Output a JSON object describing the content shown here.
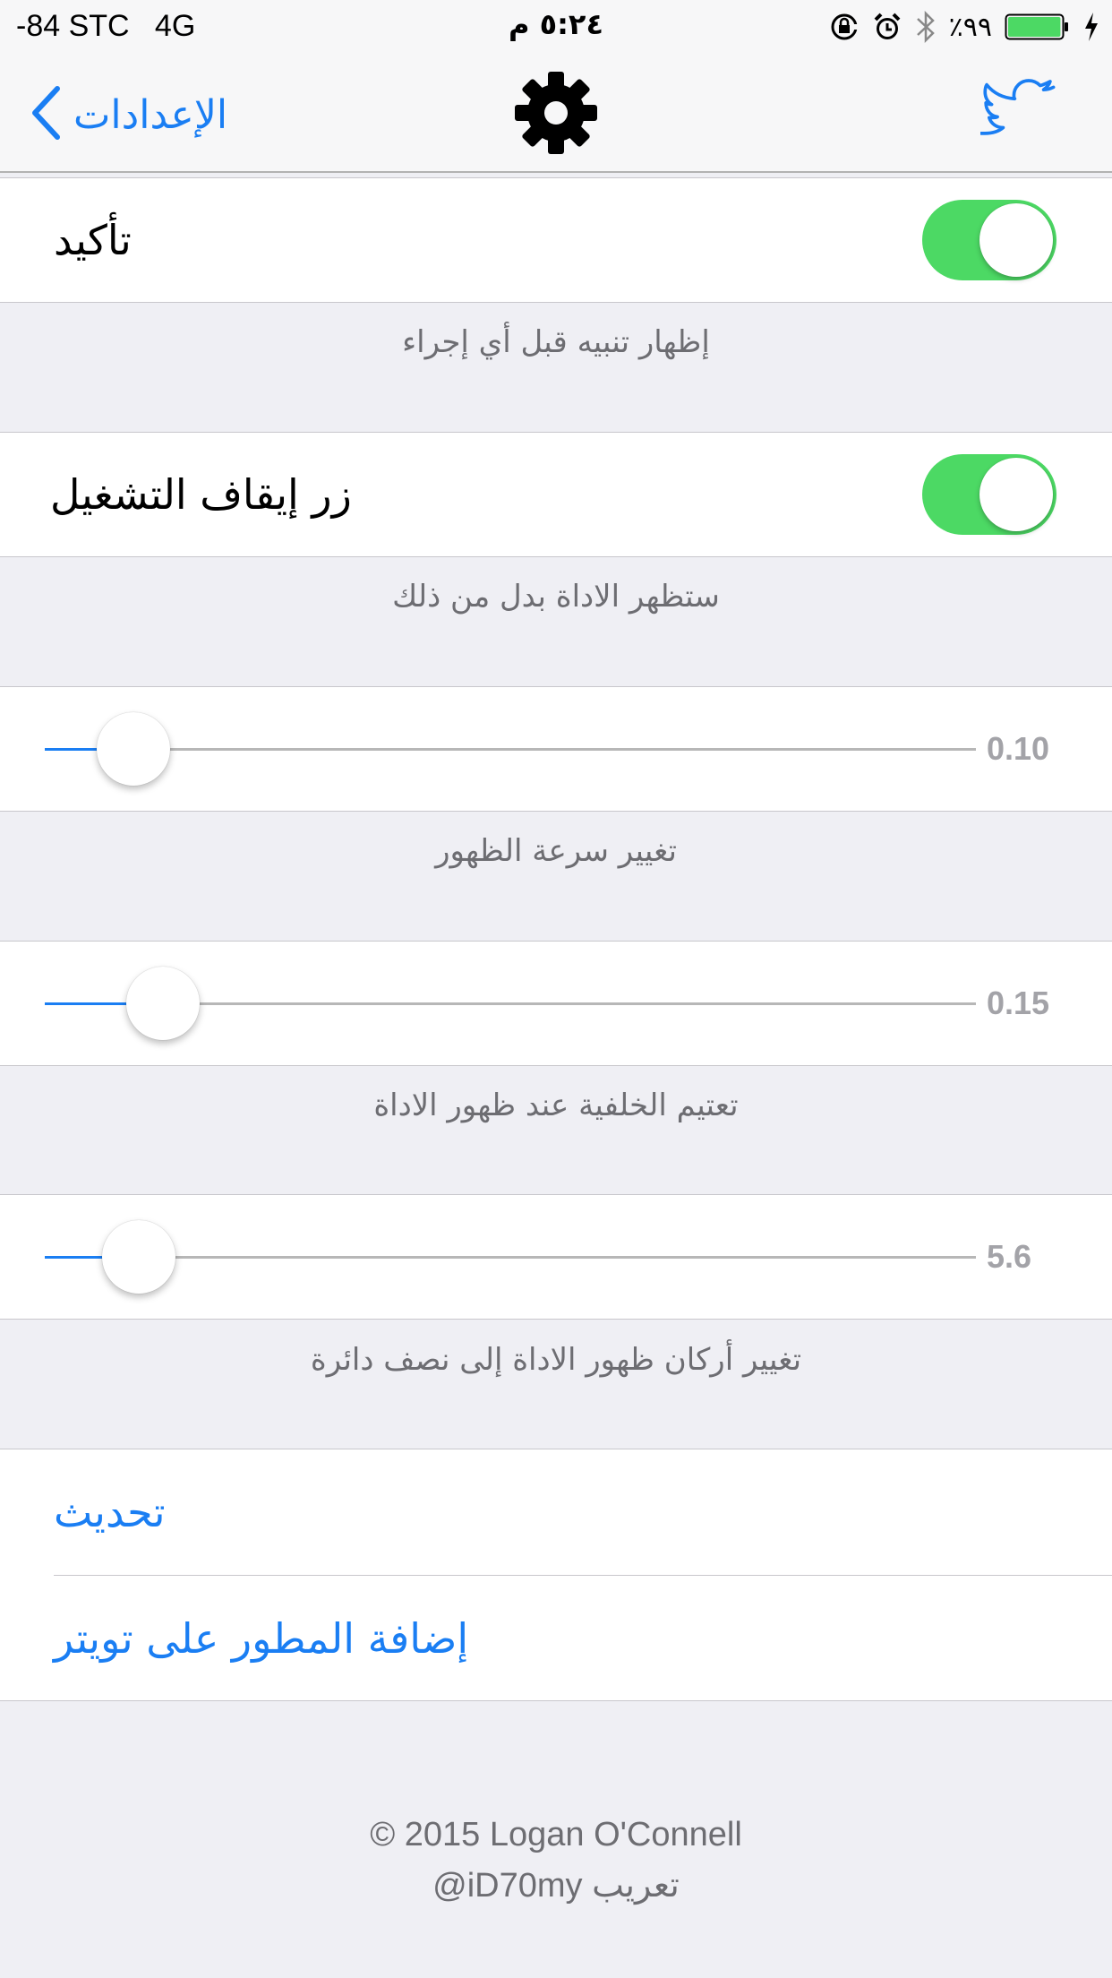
{
  "status_bar": {
    "carrier": "-84 STC   4G",
    "time": "٥:٢٤ م",
    "battery_percent": "٪٩٩",
    "battery_level": 0.99,
    "battery_color": "#4cd964"
  },
  "nav": {
    "back_label": "الإعدادات",
    "back_icon": "chevron-left-icon",
    "center_icon": "gear-icon",
    "right_icon": "twitter-bird-icon",
    "accent": "#1a7ef3"
  },
  "settings": {
    "confirm": {
      "label": "تأكيد",
      "on": true,
      "footer": "إظهار تنبيه قبل أي إجراء"
    },
    "power_button": {
      "label": "زر إيقاف التشغيل",
      "on": true,
      "footer": "ستظهر الاداة بدل من ذلك"
    },
    "speed": {
      "value": 0.1,
      "value_text": "0.10",
      "position": 0.095,
      "footer": "تغيير سرعة الظهور"
    },
    "dim": {
      "value": 0.15,
      "value_text": "0.15",
      "position": 0.127,
      "footer": "تعتيم الخلفية عند ظهور الاداة"
    },
    "corners": {
      "value": 5.6,
      "value_text": "5.6",
      "position": 0.101,
      "footer": "تغيير أركان ظهور الاداة إلى نصف دائرة"
    }
  },
  "actions": {
    "refresh_label": "تحديث",
    "follow_label": "إضافة المطور على تويتر"
  },
  "footer": {
    "copyright": "© 2015 Logan O'Connell",
    "translation": "@iD70my تعريب"
  }
}
